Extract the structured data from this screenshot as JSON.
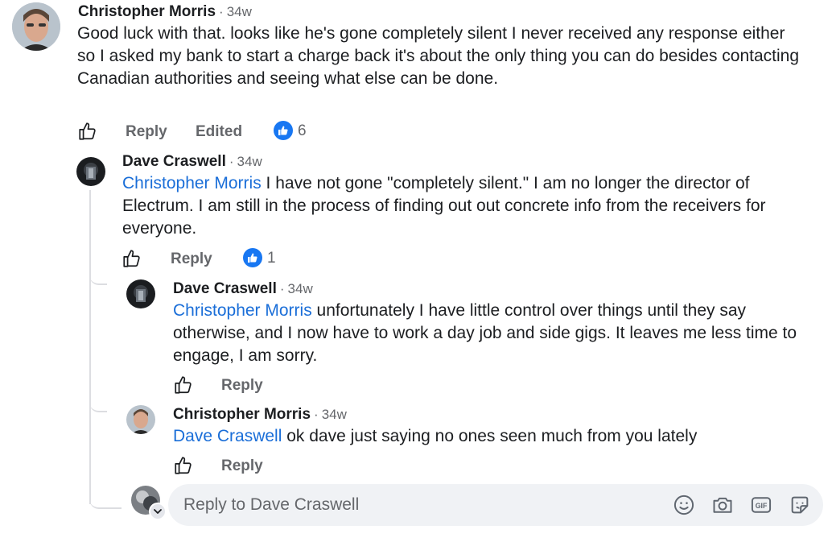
{
  "comments": [
    {
      "author": "Christopher Morris",
      "time": "34w",
      "text": "Good luck with that. looks like he's gone completely silent I never received any response either so I asked my bank to start a charge back it's about the only thing you can do besides contacting Canadian authorities and seeing what else can be done.",
      "actions": {
        "reply": "Reply",
        "edited": "Edited"
      },
      "reactions": "6"
    },
    {
      "author": "Dave Craswell",
      "time": "34w",
      "mention": "Christopher Morris",
      "text": " I have not gone \"completely silent.\" I am no longer the director of Electrum. I am still in the process of finding out out concrete info from the receivers for everyone.",
      "actions": {
        "reply": "Reply"
      },
      "reactions": "1"
    },
    {
      "author": "Dave Craswell",
      "time": "34w",
      "mention": "Christopher Morris",
      "text": " unfortunately I have little control over things until they say otherwise, and I now have to work a day job and side gigs. It leaves me less time to engage, I am sorry.",
      "actions": {
        "reply": "Reply"
      }
    },
    {
      "author": "Christopher Morris",
      "time": "34w",
      "mention": "Dave Craswell",
      "text": " ok dave just saying no ones seen much from you lately",
      "actions": {
        "reply": "Reply"
      }
    }
  ],
  "separator": "·",
  "composer": {
    "placeholder": "Reply to Dave Craswell",
    "icons": [
      "emoji-icon",
      "camera-icon",
      "gif-icon",
      "sticker-icon"
    ],
    "gif_label": "GIF"
  },
  "colors": {
    "mention": "#1a6ed8",
    "like_badge": "#1877f2",
    "meta": "#65676b"
  }
}
